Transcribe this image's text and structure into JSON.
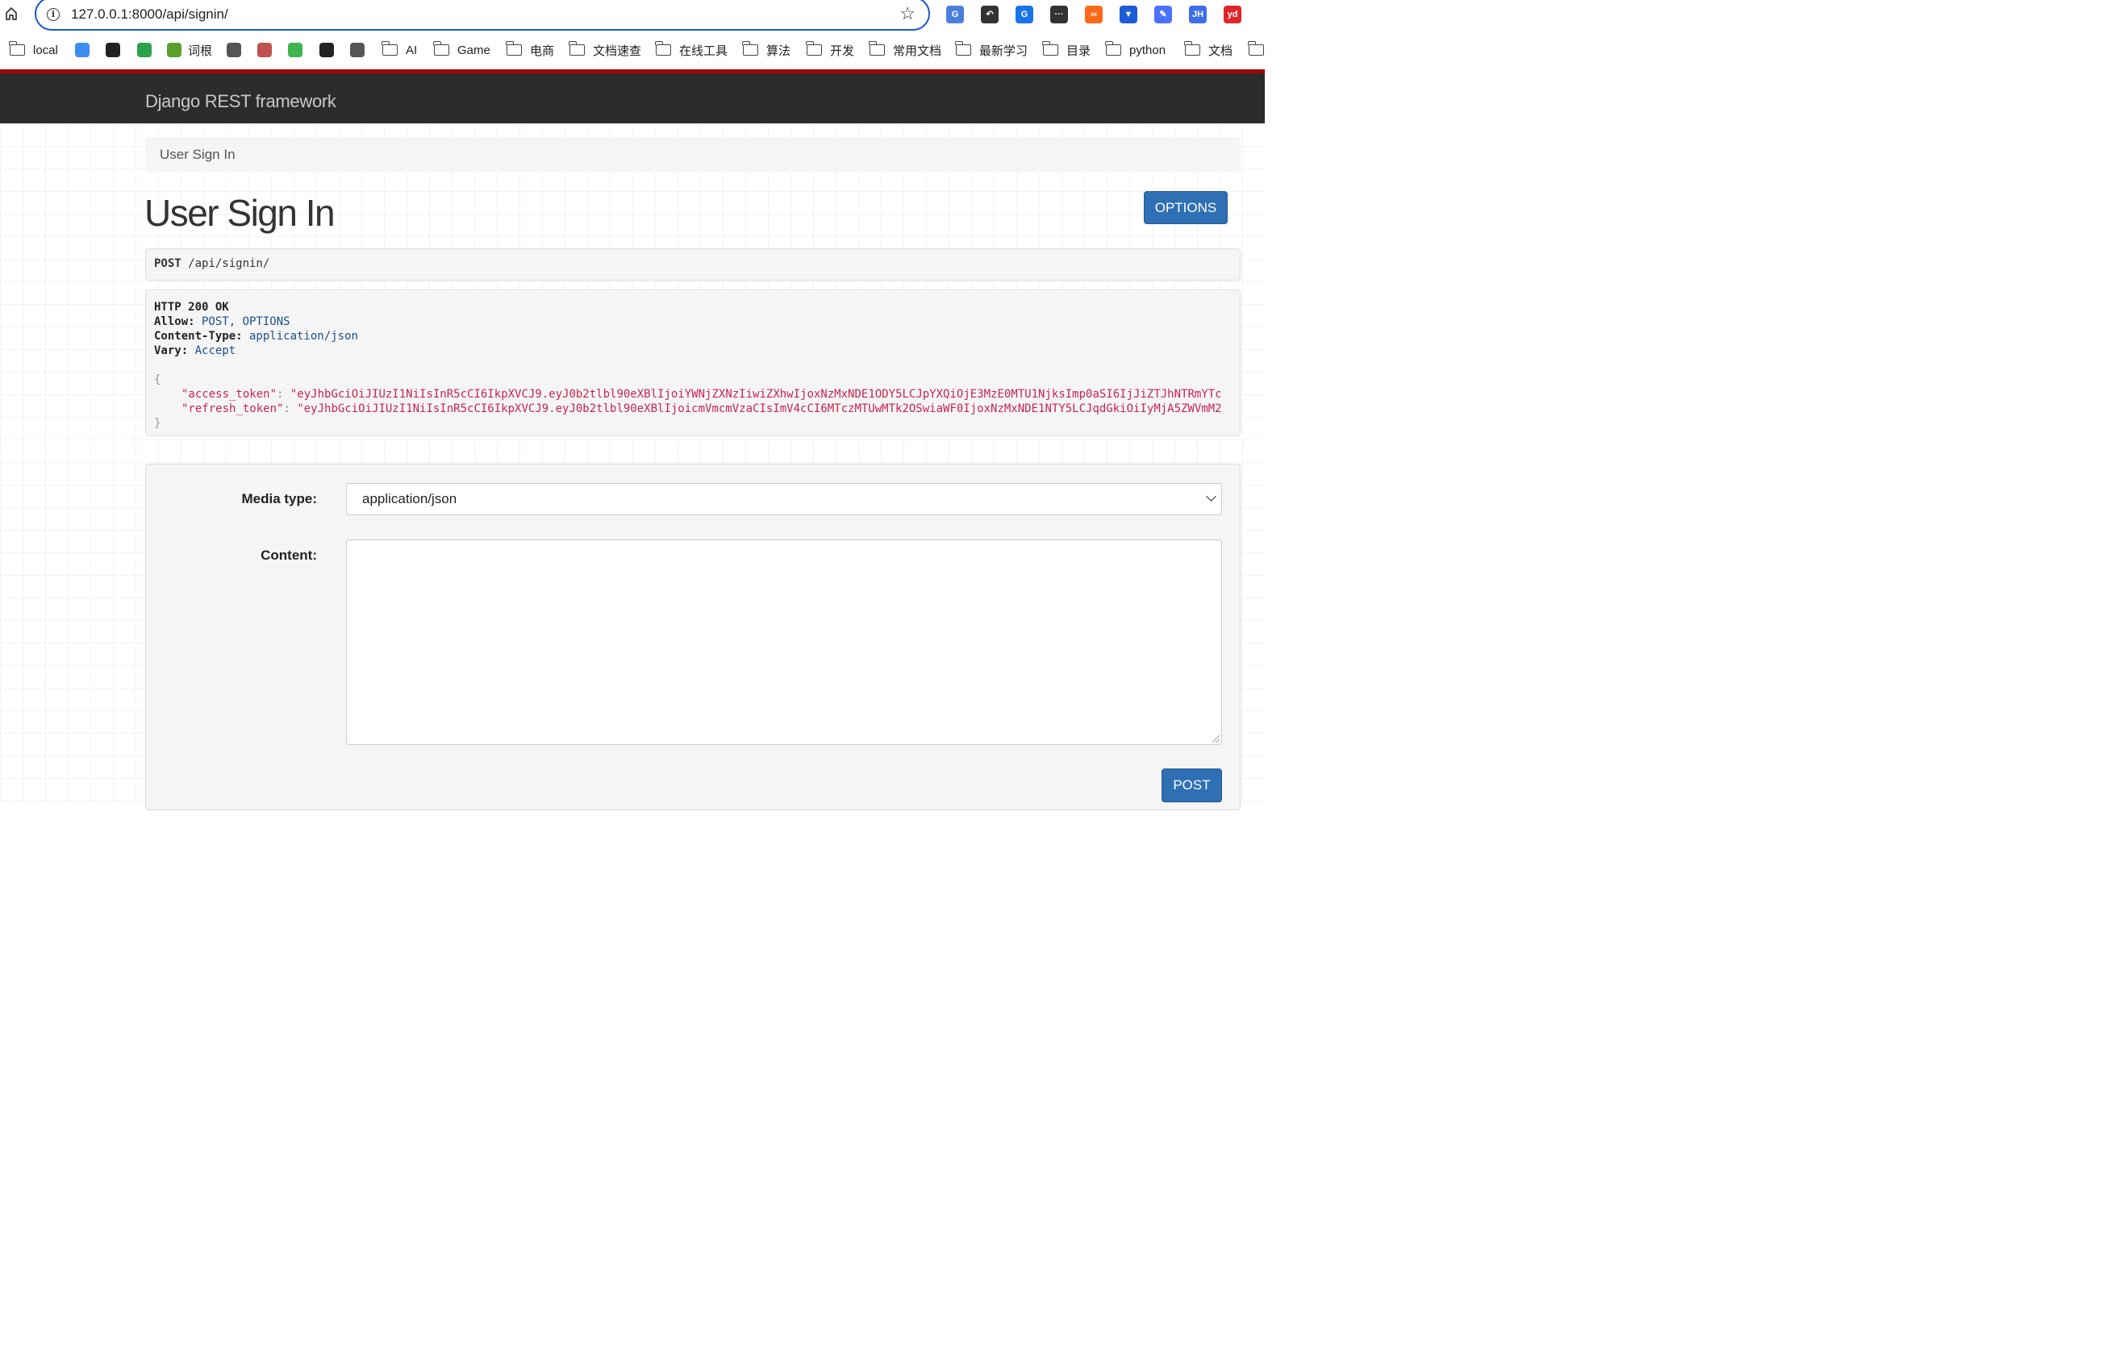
{
  "browser": {
    "url": "127.0.0.1:8000/api/signin/",
    "extensions": [
      {
        "name": "translate-extension-icon",
        "color": "#4a7fe0",
        "text": "G"
      },
      {
        "name": "refresh-arrow-extension-icon",
        "color": "#333333",
        "text": "↶"
      },
      {
        "name": "grammarly-extension-icon",
        "color": "#1a73e8",
        "text": "G"
      },
      {
        "name": "dots-extension-icon",
        "color": "#333333",
        "text": "···"
      },
      {
        "name": "infinity-extension-icon",
        "color": "#ff6a1a",
        "text": "∞"
      },
      {
        "name": "vue-devtools-extension-icon",
        "color": "#1e5bd6",
        "text": "▼"
      },
      {
        "name": "pen-extension-icon",
        "color": "#4a72ff",
        "text": "✎"
      },
      {
        "name": "jh-extension-icon",
        "color": "#3f6fe6",
        "text": "JH"
      },
      {
        "name": "yd-extension-icon",
        "color": "#e0242a",
        "text": "yd"
      }
    ],
    "bookmarks": [
      {
        "type": "folder",
        "label": "local"
      },
      {
        "type": "icon",
        "label": "",
        "color": "#3b8cf0"
      },
      {
        "type": "icon",
        "label": "",
        "color": "#222222"
      },
      {
        "type": "icon",
        "label": "",
        "color": "#2aa14a"
      },
      {
        "type": "icon",
        "label": "词根",
        "color": "#5aa02c"
      },
      {
        "type": "icon",
        "label": "",
        "color": "#555555"
      },
      {
        "type": "icon",
        "label": "",
        "color": "#c0504d"
      },
      {
        "type": "icon",
        "label": "",
        "color": "#3fb44f"
      },
      {
        "type": "icon",
        "label": "",
        "color": "#222222"
      },
      {
        "type": "icon",
        "label": "",
        "color": "#555555"
      },
      {
        "type": "folder",
        "label": "AI"
      },
      {
        "type": "folder",
        "label": "Game"
      },
      {
        "type": "folder",
        "label": "电商"
      },
      {
        "type": "folder",
        "label": "文档速查"
      },
      {
        "type": "folder",
        "label": "在线工具"
      },
      {
        "type": "folder",
        "label": "算法"
      },
      {
        "type": "folder",
        "label": "开发"
      },
      {
        "type": "folder",
        "label": "常用文档"
      },
      {
        "type": "folder",
        "label": "最新学习"
      },
      {
        "type": "folder",
        "label": "目录"
      },
      {
        "type": "folder",
        "label": "python"
      },
      {
        "type": "folder",
        "label": "文档"
      },
      {
        "type": "folder",
        "label": ""
      }
    ]
  },
  "navbar": {
    "brand": "Django REST framework"
  },
  "breadcrumb": {
    "current": "User Sign In"
  },
  "page": {
    "title": "User Sign In",
    "options_label": "OPTIONS"
  },
  "request": {
    "method": "POST",
    "path": " /api/signin/"
  },
  "response": {
    "status": "HTTP 200 OK",
    "headers": [
      {
        "key": "Allow:",
        "value": " POST, OPTIONS"
      },
      {
        "key": "Content-Type:",
        "value": " application/json"
      },
      {
        "key": "Vary:",
        "value": " Accept"
      }
    ],
    "open_brace": "{",
    "close_brace": "}",
    "body": [
      {
        "key": "\"access_token\"",
        "value": "\"eyJhbGciOiJIUzI1NiIsInR5cCI6IkpXVCJ9.eyJ0b2tlbl90eXBlIjoiYWNjZXNzIiwiZXhwIjoxNzMxNDE1ODY5LCJpYXQiOjE3MzE0MTU1NjksImp0aSI6IjJiZTJhNTRmYTc"
      },
      {
        "key": "\"refresh_token\"",
        "value": "\"eyJhbGciOiJIUzI1NiIsInR5cCI6IkpXVCJ9.eyJ0b2tlbl90eXBlIjoicmVmcmVzaCIsImV4cCI6MTczMTUwMTk2OSwiaWF0IjoxNzMxNDE1NTY5LCJqdGkiOiIyMjA5ZWVmM2"
      }
    ]
  },
  "form": {
    "media_type_label": "Media type:",
    "media_type_value": "application/json",
    "content_label": "Content:",
    "content_value": "",
    "post_label": "POST"
  }
}
